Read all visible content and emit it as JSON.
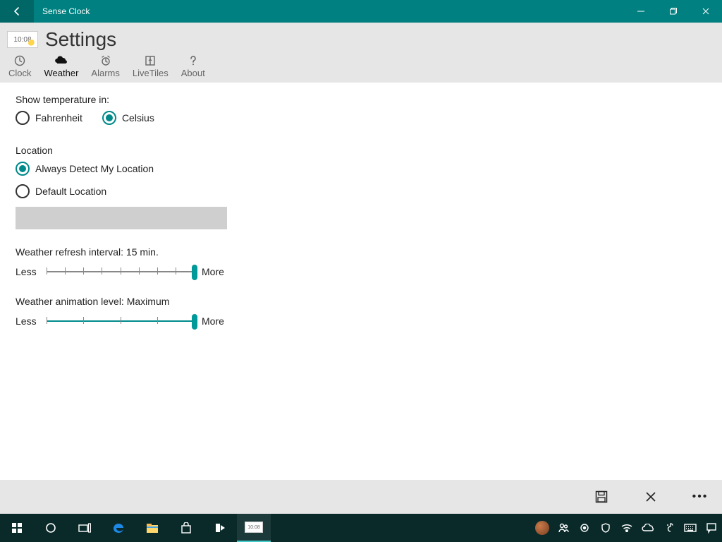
{
  "window": {
    "title": "Sense Clock"
  },
  "header": {
    "thumb_time": "10:08",
    "page_title": "Settings",
    "tabs": [
      {
        "label": "Clock",
        "active": false
      },
      {
        "label": "Weather",
        "active": true
      },
      {
        "label": "Alarms",
        "active": false
      },
      {
        "label": "LiveTiles",
        "active": false
      },
      {
        "label": "About",
        "active": false
      }
    ]
  },
  "temp": {
    "label": "Show temperature in:",
    "options": [
      "Fahrenheit",
      "Celsius"
    ],
    "selected": "Celsius"
  },
  "location": {
    "label": "Location",
    "options": [
      "Always Detect My Location",
      "Default Location"
    ],
    "selected": "Always Detect My Location",
    "default_value": ""
  },
  "refresh": {
    "label_prefix": "Weather refresh interval:",
    "value_text": "15 min.",
    "less": "Less",
    "more": "More",
    "ticks": 9,
    "position_pct": 100
  },
  "anim": {
    "label_prefix": "Weather animation level:",
    "value_text": "Maximum",
    "less": "Less",
    "more": "More",
    "ticks": 5,
    "position_pct": 100
  },
  "colors": {
    "accent": "#008a8a",
    "titlebar": "#008080"
  }
}
